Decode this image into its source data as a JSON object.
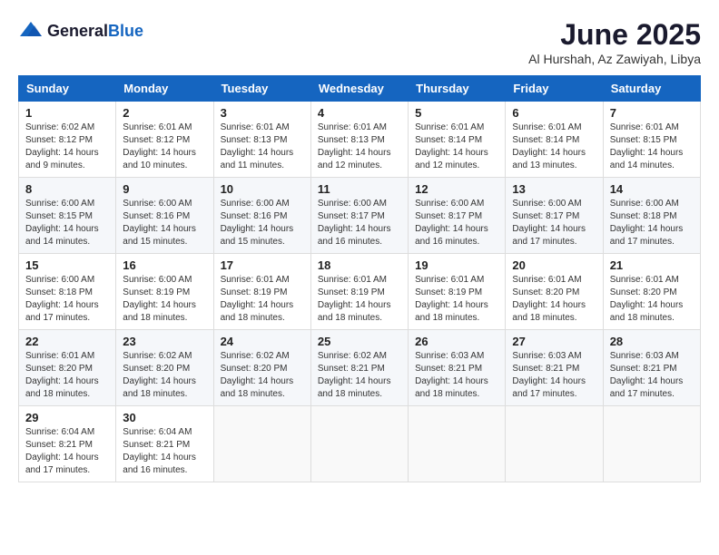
{
  "header": {
    "logo_general": "General",
    "logo_blue": "Blue",
    "month_title": "June 2025",
    "subtitle": "Al Hurshah, Az Zawiyah, Libya"
  },
  "days_of_week": [
    "Sunday",
    "Monday",
    "Tuesday",
    "Wednesday",
    "Thursday",
    "Friday",
    "Saturday"
  ],
  "weeks": [
    [
      {
        "day": "1",
        "sunrise": "6:02 AM",
        "sunset": "8:12 PM",
        "daylight": "14 hours and 9 minutes."
      },
      {
        "day": "2",
        "sunrise": "6:01 AM",
        "sunset": "8:12 PM",
        "daylight": "14 hours and 10 minutes."
      },
      {
        "day": "3",
        "sunrise": "6:01 AM",
        "sunset": "8:13 PM",
        "daylight": "14 hours and 11 minutes."
      },
      {
        "day": "4",
        "sunrise": "6:01 AM",
        "sunset": "8:13 PM",
        "daylight": "14 hours and 12 minutes."
      },
      {
        "day": "5",
        "sunrise": "6:01 AM",
        "sunset": "8:14 PM",
        "daylight": "14 hours and 12 minutes."
      },
      {
        "day": "6",
        "sunrise": "6:01 AM",
        "sunset": "8:14 PM",
        "daylight": "14 hours and 13 minutes."
      },
      {
        "day": "7",
        "sunrise": "6:01 AM",
        "sunset": "8:15 PM",
        "daylight": "14 hours and 14 minutes."
      }
    ],
    [
      {
        "day": "8",
        "sunrise": "6:00 AM",
        "sunset": "8:15 PM",
        "daylight": "14 hours and 14 minutes."
      },
      {
        "day": "9",
        "sunrise": "6:00 AM",
        "sunset": "8:16 PM",
        "daylight": "14 hours and 15 minutes."
      },
      {
        "day": "10",
        "sunrise": "6:00 AM",
        "sunset": "8:16 PM",
        "daylight": "14 hours and 15 minutes."
      },
      {
        "day": "11",
        "sunrise": "6:00 AM",
        "sunset": "8:17 PM",
        "daylight": "14 hours and 16 minutes."
      },
      {
        "day": "12",
        "sunrise": "6:00 AM",
        "sunset": "8:17 PM",
        "daylight": "14 hours and 16 minutes."
      },
      {
        "day": "13",
        "sunrise": "6:00 AM",
        "sunset": "8:17 PM",
        "daylight": "14 hours and 17 minutes."
      },
      {
        "day": "14",
        "sunrise": "6:00 AM",
        "sunset": "8:18 PM",
        "daylight": "14 hours and 17 minutes."
      }
    ],
    [
      {
        "day": "15",
        "sunrise": "6:00 AM",
        "sunset": "8:18 PM",
        "daylight": "14 hours and 17 minutes."
      },
      {
        "day": "16",
        "sunrise": "6:00 AM",
        "sunset": "8:19 PM",
        "daylight": "14 hours and 18 minutes."
      },
      {
        "day": "17",
        "sunrise": "6:01 AM",
        "sunset": "8:19 PM",
        "daylight": "14 hours and 18 minutes."
      },
      {
        "day": "18",
        "sunrise": "6:01 AM",
        "sunset": "8:19 PM",
        "daylight": "14 hours and 18 minutes."
      },
      {
        "day": "19",
        "sunrise": "6:01 AM",
        "sunset": "8:19 PM",
        "daylight": "14 hours and 18 minutes."
      },
      {
        "day": "20",
        "sunrise": "6:01 AM",
        "sunset": "8:20 PM",
        "daylight": "14 hours and 18 minutes."
      },
      {
        "day": "21",
        "sunrise": "6:01 AM",
        "sunset": "8:20 PM",
        "daylight": "14 hours and 18 minutes."
      }
    ],
    [
      {
        "day": "22",
        "sunrise": "6:01 AM",
        "sunset": "8:20 PM",
        "daylight": "14 hours and 18 minutes."
      },
      {
        "day": "23",
        "sunrise": "6:02 AM",
        "sunset": "8:20 PM",
        "daylight": "14 hours and 18 minutes."
      },
      {
        "day": "24",
        "sunrise": "6:02 AM",
        "sunset": "8:20 PM",
        "daylight": "14 hours and 18 minutes."
      },
      {
        "day": "25",
        "sunrise": "6:02 AM",
        "sunset": "8:21 PM",
        "daylight": "14 hours and 18 minutes."
      },
      {
        "day": "26",
        "sunrise": "6:03 AM",
        "sunset": "8:21 PM",
        "daylight": "14 hours and 18 minutes."
      },
      {
        "day": "27",
        "sunrise": "6:03 AM",
        "sunset": "8:21 PM",
        "daylight": "14 hours and 17 minutes."
      },
      {
        "day": "28",
        "sunrise": "6:03 AM",
        "sunset": "8:21 PM",
        "daylight": "14 hours and 17 minutes."
      }
    ],
    [
      {
        "day": "29",
        "sunrise": "6:04 AM",
        "sunset": "8:21 PM",
        "daylight": "14 hours and 17 minutes."
      },
      {
        "day": "30",
        "sunrise": "6:04 AM",
        "sunset": "8:21 PM",
        "daylight": "14 hours and 16 minutes."
      },
      null,
      null,
      null,
      null,
      null
    ]
  ]
}
